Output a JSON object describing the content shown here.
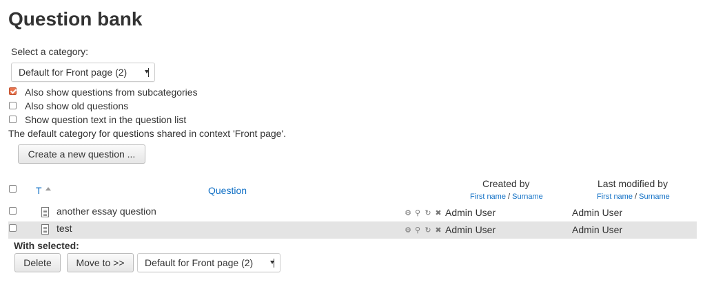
{
  "page": {
    "title": "Question bank"
  },
  "category": {
    "label": "Select a category:",
    "selected": "Default for Front page (2)"
  },
  "options": {
    "subcategories": {
      "label": "Also show questions from subcategories",
      "checked": true
    },
    "old_questions": {
      "label": "Also show old questions",
      "checked": false
    },
    "question_text": {
      "label": "Show question text in the question list",
      "checked": false
    }
  },
  "info_text": "The default category for questions shared in context 'Front page'.",
  "create_button": "Create a new question ...",
  "table": {
    "headers": {
      "type": "T",
      "question": "Question",
      "created_by": "Created by",
      "created_by_sub_first": "First name",
      "created_by_sub_sep": " / ",
      "created_by_sub_last": "Surname",
      "modified_by": "Last modified by",
      "modified_by_sub_first": "First name",
      "modified_by_sub_sep": " / ",
      "modified_by_sub_last": "Surname"
    },
    "rows": [
      {
        "name": "another essay question",
        "created_by": "Admin User",
        "modified_by": "Admin User"
      },
      {
        "name": "test",
        "created_by": "Admin User",
        "modified_by": "Admin User"
      }
    ]
  },
  "with_selected": {
    "label": "With selected:",
    "delete": "Delete",
    "move_to": "Move to >>",
    "target_category": "Default for Front page (2)"
  },
  "icons": [
    "gear-icon",
    "preview-icon",
    "move-icon",
    "delete-icon",
    "document-icon"
  ],
  "colors": {
    "link": "#0f6fc5",
    "checkbox_accent": "#e8734d",
    "row_highlight": "#e4e4e4"
  }
}
